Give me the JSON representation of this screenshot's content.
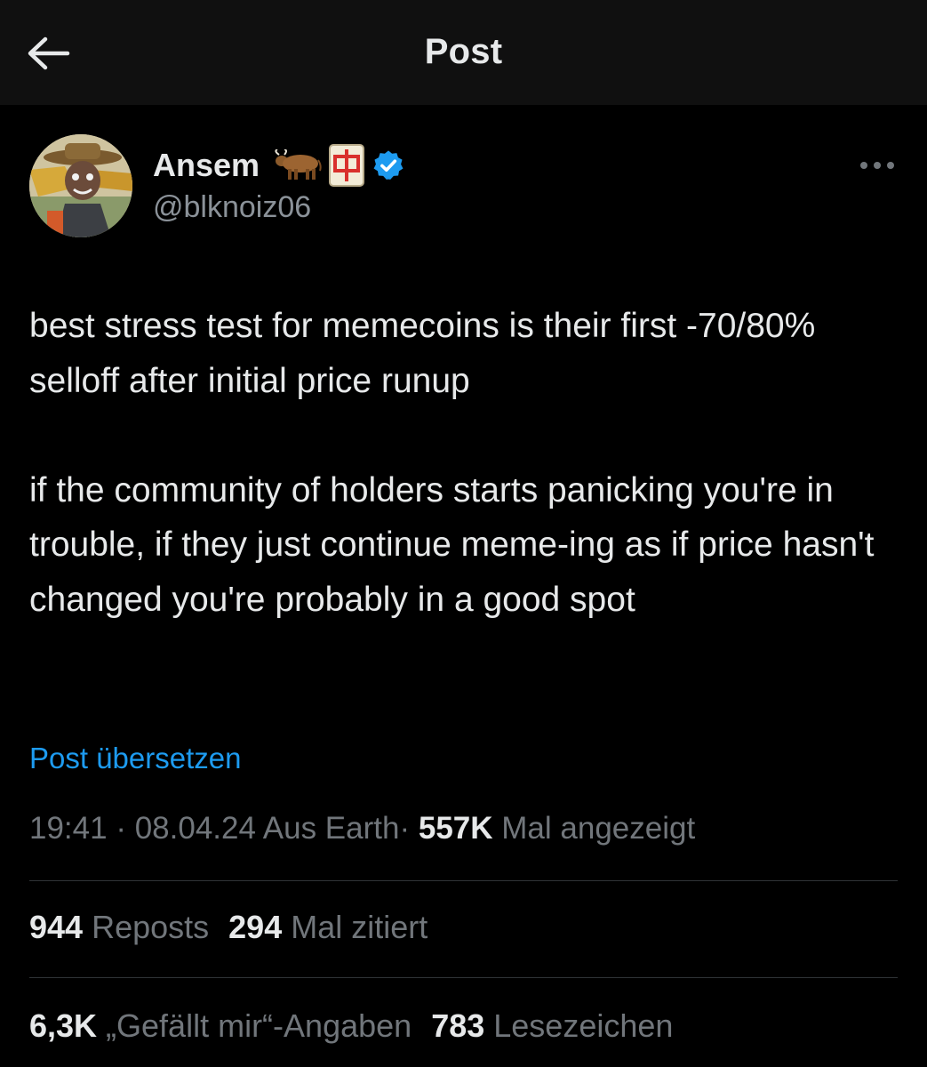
{
  "header": {
    "title": "Post"
  },
  "author": {
    "name": "Ansem",
    "handle": "@blknoiz06",
    "verified": true,
    "emojis": [
      "ox-emoji",
      "mahjong-red-dragon-emoji"
    ]
  },
  "tweet": {
    "paragraphs": [
      "best stress test for memecoins is their first -70/80% selloff after initial price runup",
      "if the community of holders starts panicking you're in trouble, if they just continue meme-ing as if price hasn't changed you're probably in a good spot"
    ],
    "translate_label": "Post übersetzen"
  },
  "meta": {
    "time": "19:41",
    "date": "08.04.24",
    "source": "Aus Earth",
    "sep": "·",
    "views_count": "557K",
    "views_label": "Mal angezeigt"
  },
  "stats": {
    "reposts_count": "944",
    "reposts_label": "Reposts",
    "quotes_count": "294",
    "quotes_label": "Mal zitiert",
    "likes_count": "6,3K",
    "likes_label": "„Gefällt mir“-Angaben",
    "bookmarks_count": "783",
    "bookmarks_label": "Lesezeichen"
  },
  "colors": {
    "background": "#000000",
    "header_bg": "#101010",
    "text": "#e7e9ea",
    "secondary_text": "#71767b",
    "accent": "#1d9bf0",
    "divider": "#2f3336"
  },
  "icons": {
    "back": "arrow-left-icon",
    "more": "more-horizontal-icon",
    "verified": "verified-badge-icon"
  }
}
